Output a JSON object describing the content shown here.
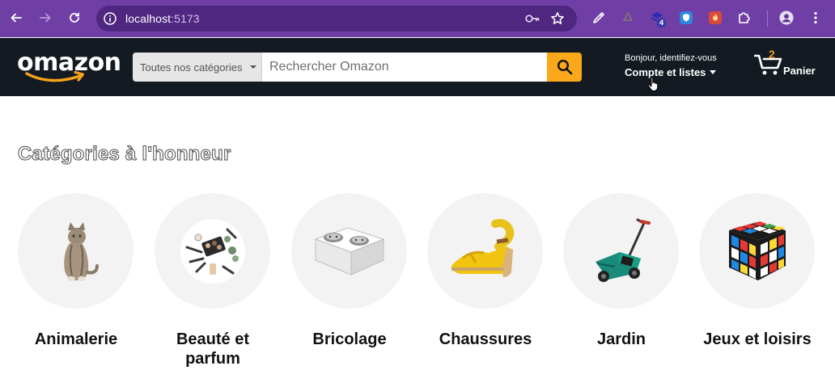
{
  "browser": {
    "url_host": "localhost",
    "url_port": ":5173",
    "extension_badge": "4"
  },
  "header": {
    "logo_text": "omazon",
    "search": {
      "category_label": "Toutes nos catégories",
      "placeholder": "Rechercher Omazon"
    },
    "account": {
      "greeting": "Bonjour, identifiez-vous",
      "lists_label": "Compte et listes"
    },
    "cart": {
      "count": "2",
      "label": "Panier"
    }
  },
  "main": {
    "section_title": "Catégories à l'honneur",
    "categories": [
      {
        "name": "Animalerie",
        "icon": "cat-image"
      },
      {
        "name": "Beauté et parfum",
        "icon": "cosmetics-image"
      },
      {
        "name": "Bricolage",
        "icon": "power-outlet-image"
      },
      {
        "name": "Chaussures",
        "icon": "wedge-sandal-image"
      },
      {
        "name": "Jardin",
        "icon": "lawn-mower-image"
      },
      {
        "name": "Jeux et loisirs",
        "icon": "rubiks-cube-image"
      }
    ]
  },
  "colors": {
    "chrome": "#6f3fa6",
    "header": "#131a22",
    "search_button": "#fba81a",
    "cart_count": "#f59b1c"
  }
}
